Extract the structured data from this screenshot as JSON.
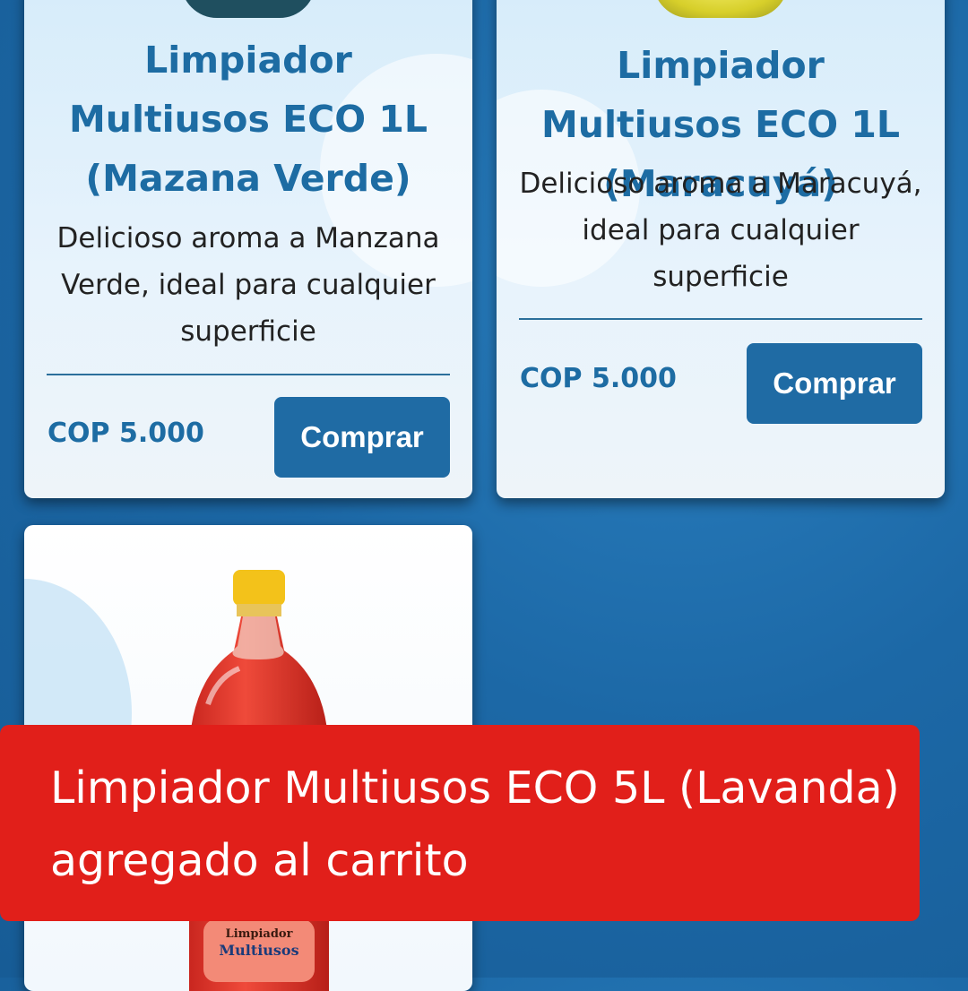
{
  "products": [
    {
      "title": "Limpiador Multiusos ECO 1L (Mazana Verde)",
      "description": "Delicioso aroma a Manzana Verde, ideal para cualquier superficie",
      "price": "COP 5.000",
      "buy_label": "Comprar"
    },
    {
      "title": "Limpiador Multiusos ECO 1L (Maracuyá)",
      "description": "Delicioso aroma a Maracuyá, ideal para cualquier superficie",
      "price": "COP 5.000",
      "buy_label": "Comprar"
    },
    {
      "label_line1": "Limpiador",
      "label_line2": "Multiusos"
    }
  ],
  "toast": {
    "message": "Limpiador Multiusos ECO 5L (Lavanda) agregado al carrito"
  },
  "colors": {
    "accent": "#1f6ba4",
    "toast_bg": "#e11f1a",
    "page_bg": "#1c68a6"
  }
}
